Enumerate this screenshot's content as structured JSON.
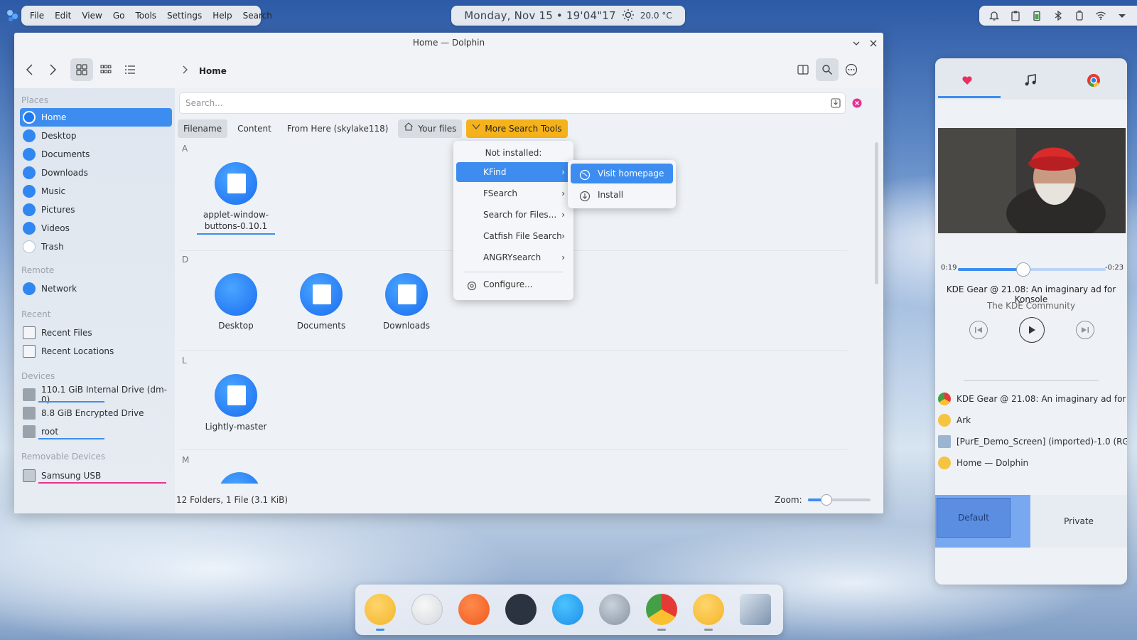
{
  "menubar": {
    "items": [
      "File",
      "Edit",
      "View",
      "Go",
      "Tools",
      "Settings",
      "Help",
      "Search"
    ]
  },
  "clock": {
    "date": "Monday, Nov 15 • 19'04\"17",
    "temperature": "20.0 °C"
  },
  "window": {
    "title": "Home — Dolphin",
    "breadcrumb": "Home",
    "search_placeholder": "Search...",
    "chips": [
      "Filename",
      "Content",
      "From Here (skylake118)",
      "Your files",
      "More Search Tools"
    ],
    "status": "12 Folders, 1 File (3.1 KiB)",
    "zoom_label": "Zoom:"
  },
  "sidebar": {
    "places_label": "Places",
    "places": [
      "Home",
      "Desktop",
      "Documents",
      "Downloads",
      "Music",
      "Pictures",
      "Videos",
      "Trash"
    ],
    "remote_label": "Remote",
    "remote": [
      "Network"
    ],
    "recent_label": "Recent",
    "recent": [
      "Recent Files",
      "Recent Locations"
    ],
    "devices_label": "Devices",
    "devices": [
      "110.1 GiB Internal Drive (dm-0)",
      "8.8 GiB Encrypted Drive",
      "root"
    ],
    "removable_label": "Removable Devices",
    "removable": [
      "Samsung USB"
    ]
  },
  "files": {
    "groups": [
      "A",
      "D",
      "L",
      "M"
    ],
    "items": [
      "applet-window-buttons-0.10.1",
      "Desktop",
      "Documents",
      "Downloads",
      "Lightly-master"
    ]
  },
  "menu": {
    "header": "Not installed:",
    "items": [
      "KFind",
      "FSearch",
      "Search for Files...",
      "Catfish File Search",
      "ANGRYsearch"
    ],
    "configure": "Configure...",
    "submenu": [
      "Visit homepage",
      "Install"
    ]
  },
  "media": {
    "elapsed": "0:19",
    "remaining": "-0:23",
    "progress": 0.44,
    "title": "KDE Gear @ 21.08: An imaginary ad for Konsole",
    "artist": "The KDE Community",
    "players": [
      "KDE Gear @ 21.08: An imaginary ad for K...",
      "Ark",
      "[PurE_Demo_Screen] (imported)-1.0 (RG...",
      "Home — Dolphin"
    ],
    "profiles": [
      "Default",
      "Private"
    ]
  },
  "colors": {
    "accent": "#3d8df0",
    "search_tools": "#f6b21b"
  }
}
